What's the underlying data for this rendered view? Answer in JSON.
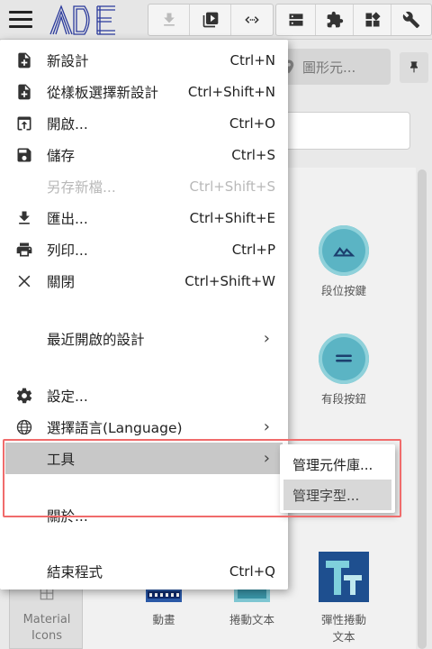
{
  "toolbar": {
    "icons": [
      "download-icon",
      "play-icon",
      "code-icon",
      "server-icon",
      "puzzle-icon",
      "widgets-icon",
      "wrench-icon"
    ]
  },
  "workspace": {
    "search_pill_label": "圖形元...",
    "widgets": [
      {
        "label": "段位按鍵"
      },
      {
        "label": "有段按鈕"
      },
      {
        "label": "動畫"
      },
      {
        "label": "捲動文本"
      },
      {
        "label": "彈性捲動\n文本"
      }
    ],
    "left_panel_label_1": "Material",
    "left_panel_label_2": "Icons"
  },
  "menu": {
    "items": [
      {
        "label": "新設計",
        "shortcut": "Ctrl+N",
        "icon": "new-file-icon"
      },
      {
        "label": "從樣板選擇新設計",
        "shortcut": "Ctrl+Shift+N",
        "icon": "template-icon"
      },
      {
        "label": "開啟...",
        "shortcut": "Ctrl+O",
        "icon": "open-icon"
      },
      {
        "label": "儲存",
        "shortcut": "Ctrl+S",
        "icon": "save-icon"
      },
      {
        "label": "另存新檔...",
        "shortcut": "Ctrl+Shift+S",
        "icon": ""
      },
      {
        "label": "匯出...",
        "shortcut": "Ctrl+Shift+E",
        "icon": "export-icon"
      },
      {
        "label": "列印...",
        "shortcut": "Ctrl+P",
        "icon": "print-icon"
      },
      {
        "label": "關閉",
        "shortcut": "Ctrl+Shift+W",
        "icon": "close-icon"
      },
      {
        "label": "最近開啟的設計",
        "shortcut": "",
        "icon": ""
      },
      {
        "label": "設定...",
        "shortcut": "",
        "icon": "gear-icon"
      },
      {
        "label": "選擇語言(Language)",
        "shortcut": "",
        "icon": "globe-icon"
      },
      {
        "label": "工具",
        "shortcut": "",
        "icon": ""
      },
      {
        "label": "關於...",
        "shortcut": "",
        "icon": ""
      },
      {
        "label": "結束程式",
        "shortcut": "Ctrl+Q",
        "icon": ""
      }
    ]
  },
  "submenu": {
    "items": [
      {
        "label": "管理元件庫..."
      },
      {
        "label": "管理字型..."
      }
    ]
  },
  "colors": {
    "highlight_border": "#f06b6b",
    "accent_teal": "#5bb4c4",
    "logo_blue": "#2b3a9c"
  }
}
